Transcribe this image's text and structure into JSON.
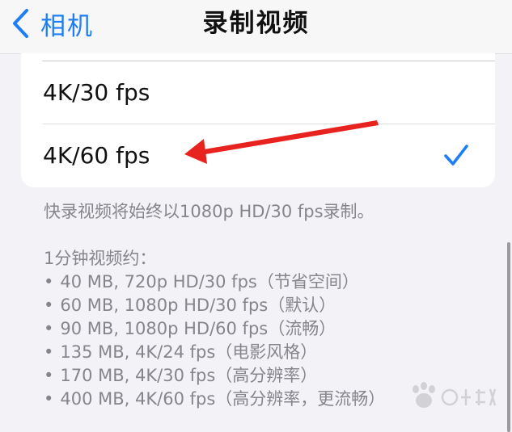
{
  "navbar": {
    "back_label": "相机",
    "title": "录制视频"
  },
  "options": [
    {
      "label": "4K/30 fps",
      "selected": false
    },
    {
      "label": "4K/60 fps",
      "selected": true
    }
  ],
  "footnote": "快录视频将始终以1080p HD/30 fps录制。",
  "sizes": {
    "heading": "1分钟视频约：",
    "items": [
      "40 MB, 720p HD/30 fps（节省空间）",
      "60 MB, 1080p HD/30 fps（默认）",
      "90 MB, 1080p HD/60 fps（流畅）",
      "135 MB, 4K/24 fps（电影风格）",
      "170 MB, 4K/30 fps（高分辨率）",
      "400 MB, 4K/60 fps（高分辨率，更流畅）"
    ]
  },
  "colors": {
    "accent": "#1e7ef6",
    "annotation_arrow": "#e8231f",
    "secondary_text": "#85858b",
    "background": "#f2f2f7"
  },
  "icons": {
    "back": "chevron-left-icon",
    "selected": "checkmark-icon",
    "annotation": "red-arrow-annotation",
    "watermark": "baidu-paw-watermark"
  }
}
